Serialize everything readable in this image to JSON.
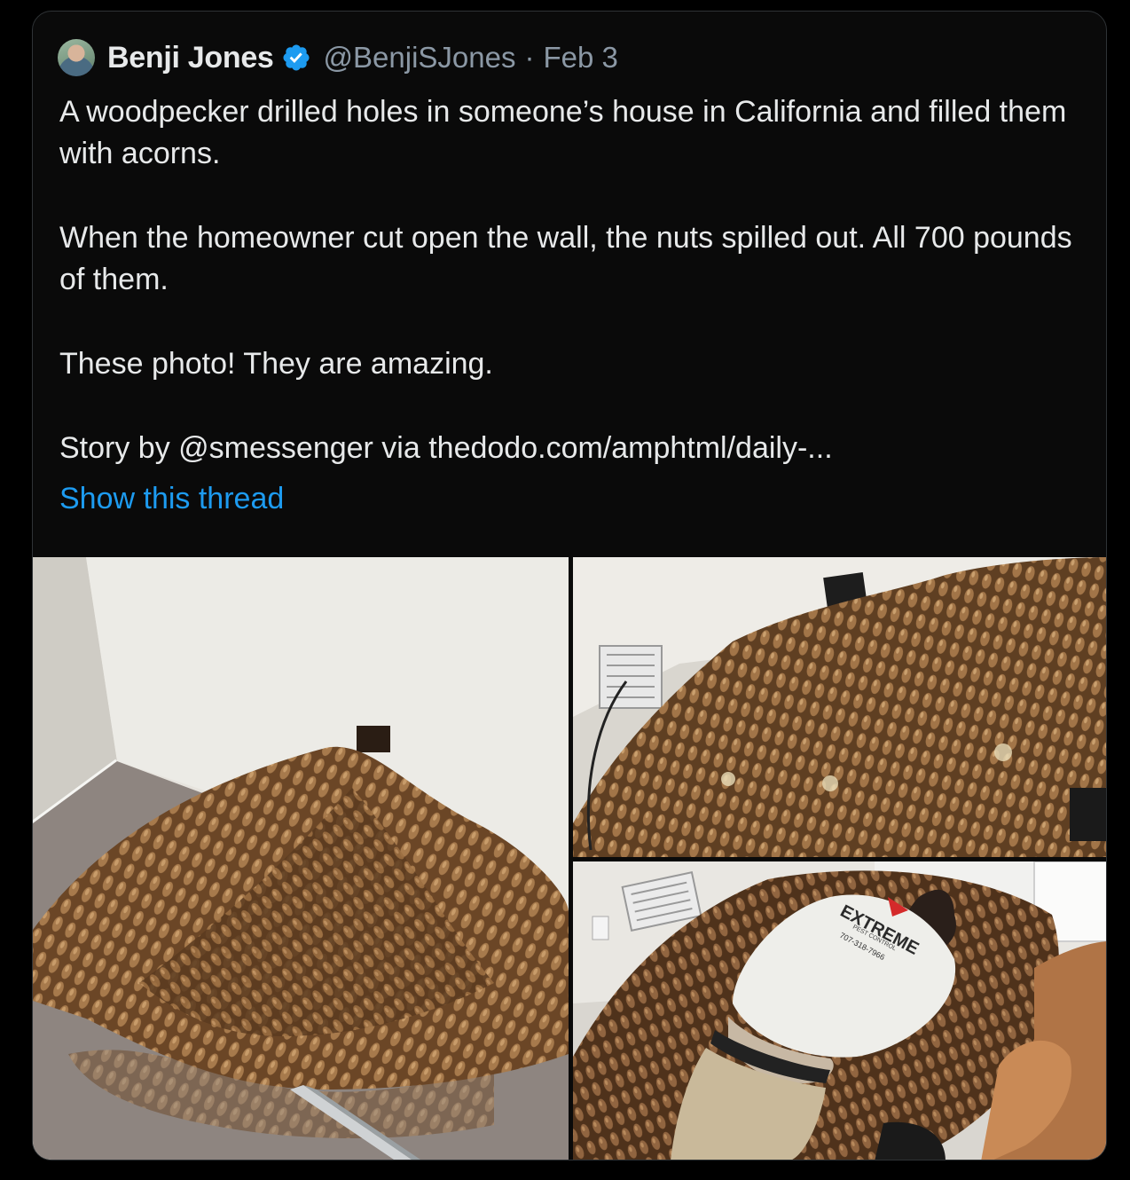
{
  "tweet": {
    "author_name": "Benji Jones",
    "handle": "@BenjiSJones",
    "separator": "·",
    "date": "Feb 3",
    "paragraphs": [
      "A woodpecker drilled holes in someone’s house in California and filled them with acorns.",
      "When the homeowner cut open the wall, the nuts spilled out. All 700 pounds of them.",
      "These photo! They are amazing.",
      "Story by @smessenger via thedodo.com/amphtml/daily-..."
    ],
    "show_thread_label": "Show this thread"
  },
  "photo_3_shirt": {
    "brand": "EXTREME",
    "sub": "PEST CONTROL",
    "phone": "707-318-7966"
  },
  "colors": {
    "background": "#000000",
    "card": "#0a0a0a",
    "border": "#2f3336",
    "text": "#e7e9ea",
    "muted": "#8b98a5",
    "link": "#1d9bf0",
    "verified_badge": "#1d9bf0"
  },
  "icons": {
    "verified": "verified-badge-icon"
  }
}
